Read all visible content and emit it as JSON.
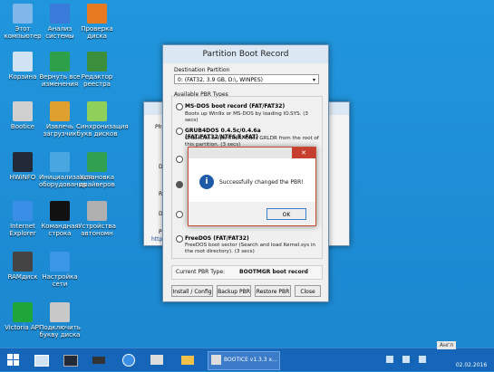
{
  "desktop": {
    "icons": [
      {
        "label": "Этот компьютер",
        "color": "#7fb7ea"
      },
      {
        "label": "Анализ системы",
        "color": "#3a7ad8"
      },
      {
        "label": "Проверка диска",
        "color": "#e67a20"
      },
      {
        "label": "Корзина",
        "color": "#cfe3f5"
      },
      {
        "label": "Вернуть все изменения",
        "color": "#2ea04a"
      },
      {
        "label": "Редактор реестра",
        "color": "#3b8e3b"
      },
      {
        "label": "Bootice",
        "color": "#d0d0d0"
      },
      {
        "label": "Извлечь загрузчик",
        "color": "#e0a030"
      },
      {
        "label": "Синхронизация букв дисков",
        "color": "#8fd05a"
      },
      {
        "label": "HWiNFO",
        "color": "#222a3a"
      },
      {
        "label": "Инициализация оборудования",
        "color": "#4aa6e0"
      },
      {
        "label": "Установка драйверов",
        "color": "#30a050"
      },
      {
        "label": "Internet Explorer",
        "color": "#3a8ee6"
      },
      {
        "label": "Командная строка",
        "color": "#111111"
      },
      {
        "label": "Устройства автономн",
        "color": "#b0b0b0"
      },
      {
        "label": "RAMдиск",
        "color": "#444444"
      },
      {
        "label": "Настройка сети",
        "color": "#3a96e6"
      },
      {
        "label": "Victoria API",
        "color": "#1ea63a"
      },
      {
        "label": "Подключить букву диска",
        "color": "#c8c8c8"
      }
    ]
  },
  "back_window": {
    "tab_label": "Phy",
    "rows": [
      "D",
      "R",
      "D",
      "P"
    ],
    "link_text": "http"
  },
  "pbr_window": {
    "title": "Partition Boot Record",
    "destination_label": "Destination Partition",
    "destination_value": "0: (FAT32,   3.9 GB, D:\\, WINPES)",
    "pbr_types_label": "Available PBR Types",
    "options": [
      {
        "title": "MS-DOS boot record (FAT/FAT32)",
        "desc": "Boots up Win9x or MS-DOS by loading IO.SYS. (3 secs)"
      },
      {
        "title": "GRUB4DOS 0.4.5c/0.4.6a (FAT/FAT32/NTFS/ExFAT)",
        "desc": "Grub4Dos on partition, loads GRLDR from the root of this partition. (3 secs)"
      },
      {
        "title": "FreeDOS (FAT/FAT32)",
        "desc": "FreeDOS boot sector (Search and load Kernel.sys in the root directory). (3 secs)"
      }
    ],
    "current_label": "Current PBR Type:",
    "current_value": "BOOTMGR boot record",
    "buttons": [
      "Install / Config",
      "Backup PBR",
      "Restore PBR",
      "Close"
    ]
  },
  "dialog": {
    "message": "Successfully changed the PBR!",
    "ok_label": "OK",
    "close_glyph": "✕"
  },
  "taskbar": {
    "task_label": "BOOTICE v1.3.3 x...",
    "tray_text": "Англ",
    "date": "02.02.2016"
  }
}
